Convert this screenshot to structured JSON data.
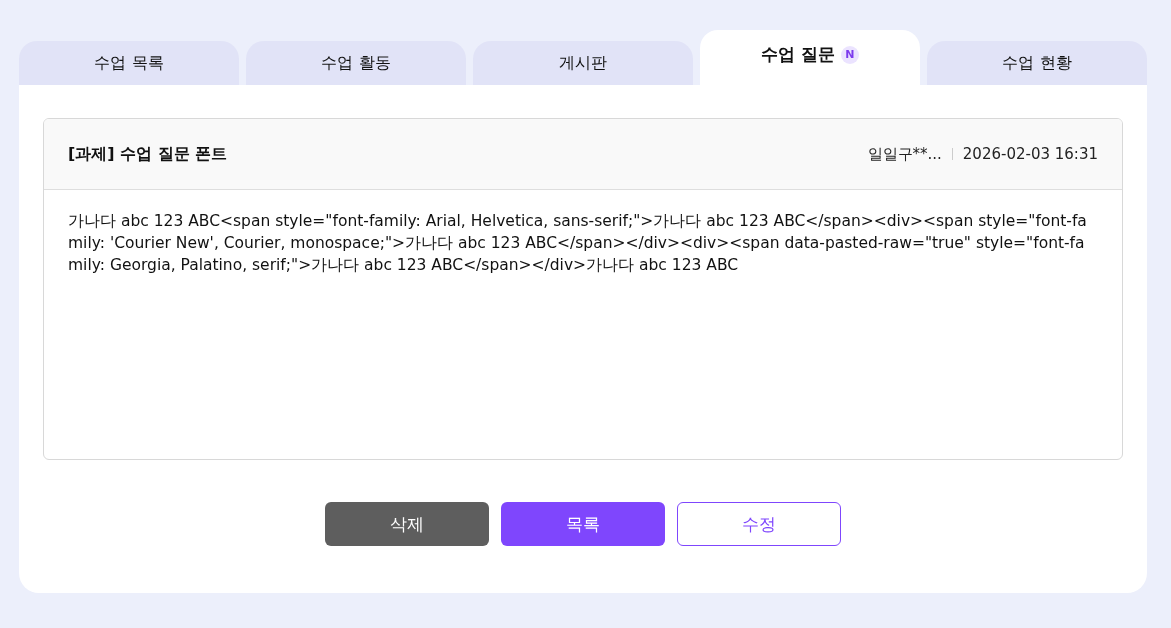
{
  "tabs": [
    {
      "label": "수업 목록",
      "selected": false
    },
    {
      "label": "수업 활동",
      "selected": false
    },
    {
      "label": "게시판",
      "selected": false
    },
    {
      "label": "수업 질문",
      "selected": true,
      "badge": "N"
    },
    {
      "label": "수업 현황",
      "selected": false
    }
  ],
  "post": {
    "title": "[과제] 수업 질문 폰트",
    "author": "일일구**...",
    "date": "2026-02-03 16:31",
    "body": "가나다 abc 123 ABC<span style=\"font-family: Arial, Helvetica, sans-serif;\">가나다 abc 123 ABC</span><div><span style=\"font-family: 'Courier New', Courier, monospace;\">가나다 abc 123 ABC</span></div><div><span data-pasted-raw=\"true\" style=\"font-family: Georgia, Palatino, serif;\">가나다 abc 123 ABC</span></div>가나다 abc 123 ABC"
  },
  "buttons": [
    {
      "label": "삭제",
      "kind": "dark"
    },
    {
      "label": "목록",
      "kind": "primary"
    },
    {
      "label": "수정",
      "kind": "outline"
    }
  ]
}
